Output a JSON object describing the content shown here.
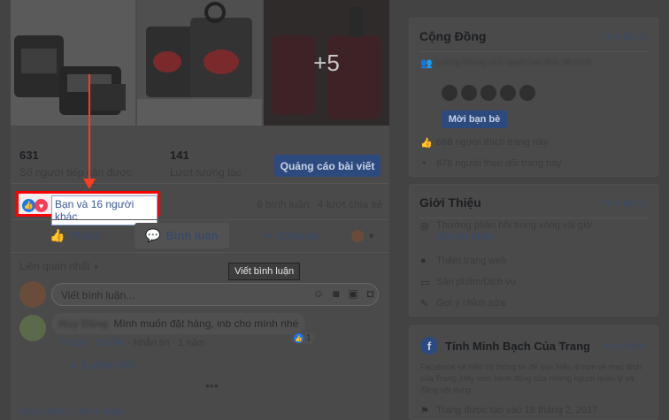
{
  "post": {
    "photos_more": "+5",
    "stats": {
      "reach_value": "631",
      "reach_label": "Số người tiếp cận được",
      "engagement_value": "141",
      "engagement_label": "Lượt tương tác",
      "boost_label": "Quảng cáo bài viết"
    },
    "reactions": {
      "names": "Bạn và 16 người khác",
      "comments": "6 bình luận",
      "shares": "4 lượt chia sẻ"
    },
    "actions": {
      "like": "Thích",
      "comment": "Bình luận",
      "share": "Chia sẻ"
    },
    "sort_label": "Liên quan nhất",
    "tooltip": "Viết bình luận",
    "comment_placeholder": "Viết bình luận...",
    "comment": {
      "author": "Huy Đăng",
      "text": "Mình muốn đặt hàng, inb cho mình nhé",
      "like": "Thích",
      "reply": "Trả lời",
      "message": "Nhắn tin",
      "time": "1 năm",
      "like_count": "1"
    },
    "replies": "3 phản hồi",
    "more_comments": "Xem thêm 1 bình luận"
  },
  "community": {
    "title": "Cộng Đồng",
    "see_all": "Xem tất cả",
    "invite_text": "Lương Nhung và 6 người bạn khác đã thích",
    "invite_button": "Mời bạn bè",
    "likes": "668 người thích trang này",
    "follows": "676 người theo dõi trang này"
  },
  "about": {
    "title": "Giới Thiệu",
    "see_all": "Xem tất cả",
    "response": "Thường phản hồi trong vòng vài giờ",
    "send_message": "Gửi tin nhắn",
    "add_website": "Thêm trang web",
    "products": "Sản phẩm/Dịch vụ",
    "suggest_edits": "Gợi ý chỉnh sửa"
  },
  "transparency": {
    "title": "Tính Minh Bạch Của Trang",
    "see_more": "Xem thêm",
    "desc": "Facebook sẽ hiển thị thông tin để bạn hiểu rõ hơn về mục đích của Trang. Hãy xem hành động của những người quản lý và đăng nội dung.",
    "created": "Trang được tạo vào 18 tháng 2, 2017"
  },
  "colors": {
    "highlight_border": "#ff0000",
    "arrow": "#ff3b1f",
    "like_blue": "#1877f2",
    "love_red": "#f33e58"
  }
}
